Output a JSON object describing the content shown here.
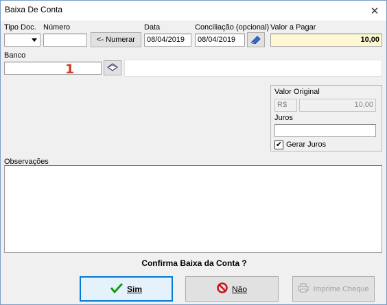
{
  "window": {
    "title": "Baixa De Conta",
    "close_symbol": "✕"
  },
  "labels": {
    "tipo_doc": "Tipo Doc.",
    "numero": "Número",
    "data": "Data",
    "conciliacao": "Conciliação (opcional)",
    "valor_a_pagar": "Valor a Pagar",
    "banco": "Banco",
    "valor_original": "Valor Original",
    "juros": "Juros",
    "observacoes": "Observações"
  },
  "fields": {
    "tipo_doc_value": "",
    "numero_value": "",
    "data_value": "08/04/2019",
    "conciliacao_value": "08/04/2019",
    "valor_a_pagar_value": "10,00",
    "banco_value": "",
    "currency_value": "R$",
    "valor_original_value": "10,00",
    "juros_value": "",
    "observacoes_value": ""
  },
  "buttons": {
    "numerar": "<- Numerar",
    "sim": "Sim",
    "nao": "Não",
    "imprime_cheque": "Imprime Cheque"
  },
  "checkbox": {
    "gerar_juros_label": "Gerar Juros",
    "gerar_juros_checked": true,
    "check_glyph": "✔"
  },
  "prompt": "Confirma Baixa da Conta ?",
  "annotation": "1",
  "icons": {
    "sim": "checkmark-icon",
    "nao": "no-entry-icon",
    "imprime": "printer-icon",
    "eraser": "eraser-icon",
    "lookup": "book-icon"
  },
  "colors": {
    "valor_pagar_bg": "#fdf8d2",
    "accent": "#0078d7",
    "annotation": "#d03a2a",
    "check_green": "#1a9a1a",
    "no_red": "#c4161c"
  }
}
